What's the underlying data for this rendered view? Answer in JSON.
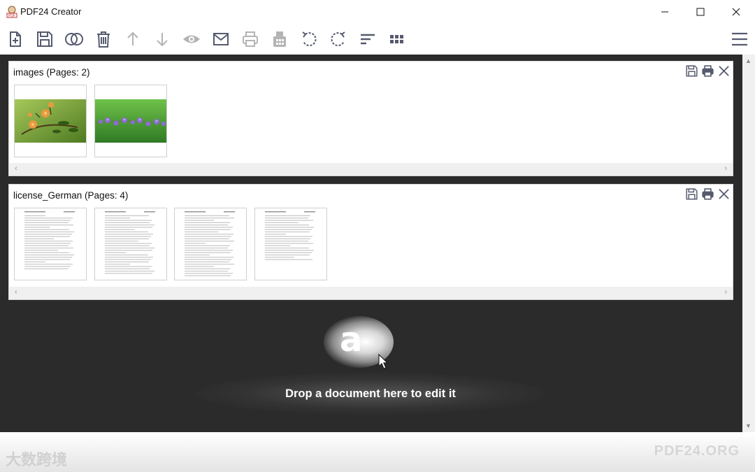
{
  "window": {
    "title": "PDF24 Creator"
  },
  "toolbar": {
    "buttons": [
      {
        "icon": "add-file-icon",
        "enabled": true
      },
      {
        "icon": "save-icon",
        "enabled": true
      },
      {
        "icon": "merge-icon",
        "enabled": true
      },
      {
        "icon": "trash-icon",
        "enabled": true
      },
      {
        "icon": "arrow-up-icon",
        "enabled": false
      },
      {
        "icon": "arrow-down-icon",
        "enabled": false
      },
      {
        "icon": "eye-icon",
        "enabled": false
      },
      {
        "icon": "mail-icon",
        "enabled": true
      },
      {
        "icon": "print-icon",
        "enabled": false
      },
      {
        "icon": "fax-icon",
        "enabled": false
      },
      {
        "icon": "rotate-left-icon",
        "enabled": true
      },
      {
        "icon": "rotate-right-icon",
        "enabled": true
      },
      {
        "icon": "sort-icon",
        "enabled": true
      },
      {
        "icon": "grid-icon",
        "enabled": true
      }
    ],
    "menu_icon": "hamburger-icon"
  },
  "documents": [
    {
      "title": "images (Pages: 2)",
      "pages": [
        {
          "kind": "photo-flowers"
        },
        {
          "kind": "photo-lavender"
        }
      ]
    },
    {
      "title": "license_German (Pages: 4)",
      "pages": [
        {
          "kind": "text"
        },
        {
          "kind": "text"
        },
        {
          "kind": "text"
        },
        {
          "kind": "text-short"
        }
      ]
    }
  ],
  "drop_zone": {
    "icon_letter": "a",
    "text": "Drop a document here to edit it"
  },
  "footer": {
    "brand": "PDF24.ORG",
    "watermark": "大数跨境"
  },
  "colors": {
    "icon": "#555a6e",
    "icon_disabled": "#b4b4b4",
    "workspace": "#2b2b2b"
  }
}
